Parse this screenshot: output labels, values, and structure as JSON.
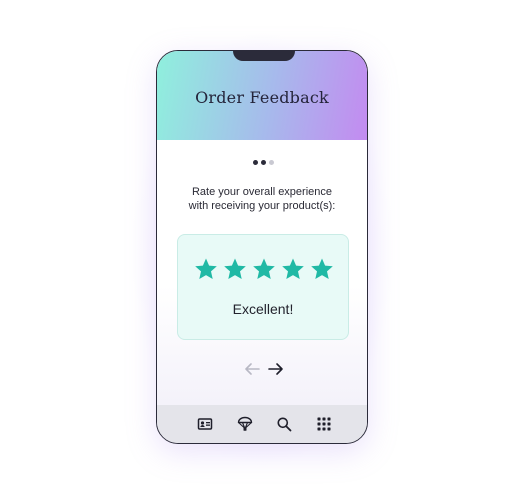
{
  "header": {
    "title": "Order Feedback"
  },
  "pager": {
    "total_steps": 3,
    "current_step": 2
  },
  "question": {
    "line1": "Rate your overall experience",
    "line2": "with receiving your product(s):"
  },
  "rating": {
    "value": 5,
    "max": 5,
    "label": "Excellent!"
  },
  "navigation": {
    "back_icon": "arrow-left-icon",
    "next_icon": "arrow-right-icon"
  },
  "bottom_nav": {
    "items": [
      {
        "icon": "id-card-icon"
      },
      {
        "icon": "parachute-icon"
      },
      {
        "icon": "search-icon"
      },
      {
        "icon": "grid-icon"
      }
    ]
  },
  "colors": {
    "accent_star": "#20b9a5",
    "header_gradient_start": "#8ff0dd",
    "header_gradient_end": "#c38bf0",
    "card_background": "#e8faf7",
    "dot_active": "#2b2b3a",
    "dot_inactive": "#c9c9d2",
    "arrow_disabled": "#b8b8c4"
  }
}
